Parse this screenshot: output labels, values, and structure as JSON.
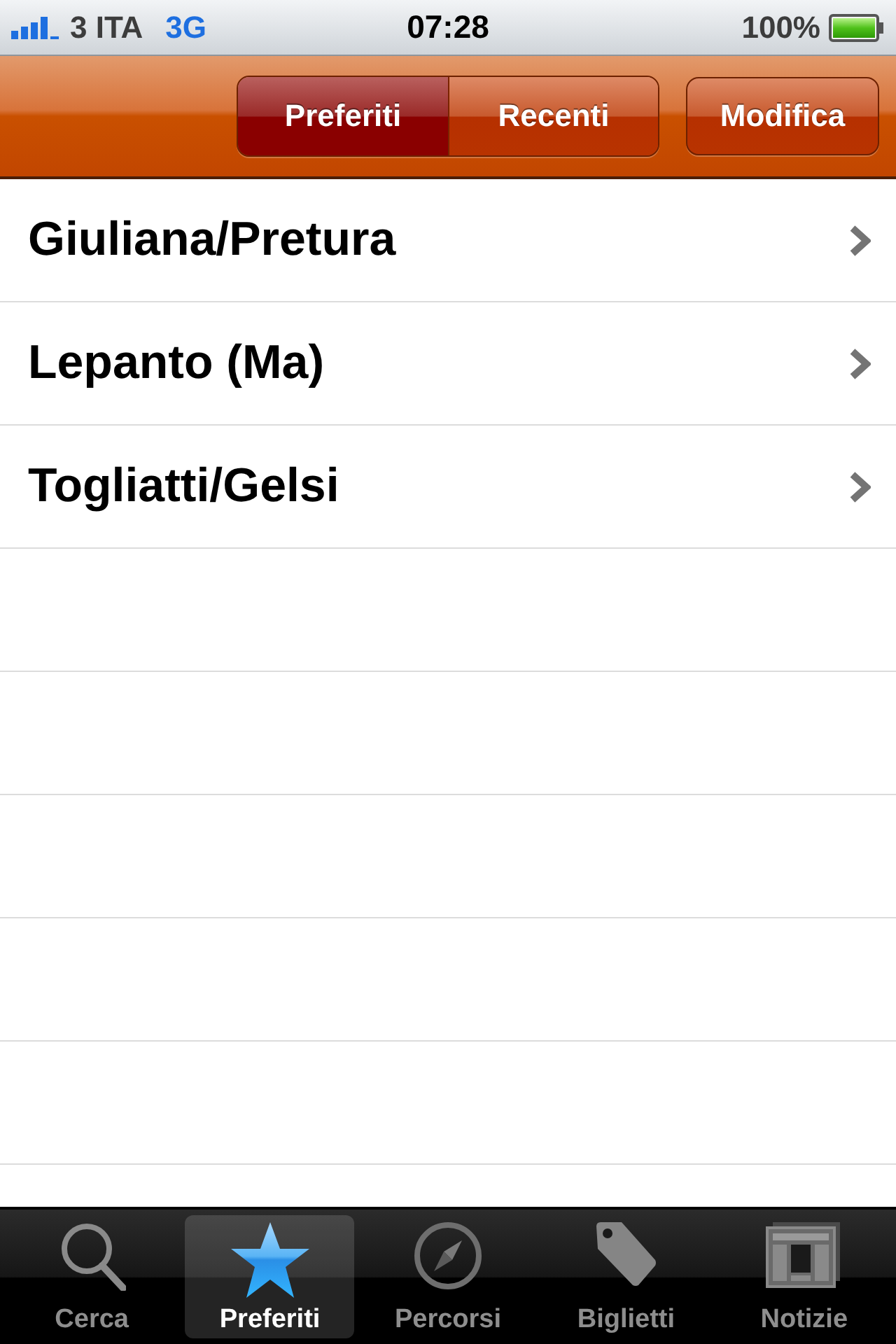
{
  "status_bar": {
    "carrier": "3 ITA",
    "network": "3G",
    "time": "07:28",
    "battery": "100%"
  },
  "nav_bar": {
    "segments": [
      {
        "label": "Preferiti",
        "selected": true
      },
      {
        "label": "Recenti",
        "selected": false
      }
    ],
    "edit_button": "Modifica"
  },
  "list": {
    "rows": [
      {
        "label": "Giuliana/Pretura"
      },
      {
        "label": "Lepanto (Ma)"
      },
      {
        "label": "Togliatti/Gelsi"
      }
    ]
  },
  "tab_bar": {
    "tabs": [
      {
        "label": "Cerca",
        "kind": "search",
        "selected": false
      },
      {
        "label": "Preferiti",
        "kind": "star",
        "selected": true
      },
      {
        "label": "Percorsi",
        "kind": "compass",
        "selected": false
      },
      {
        "label": "Biglietti",
        "kind": "tag",
        "selected": false
      },
      {
        "label": "Notizie",
        "kind": "news",
        "selected": false
      }
    ]
  }
}
